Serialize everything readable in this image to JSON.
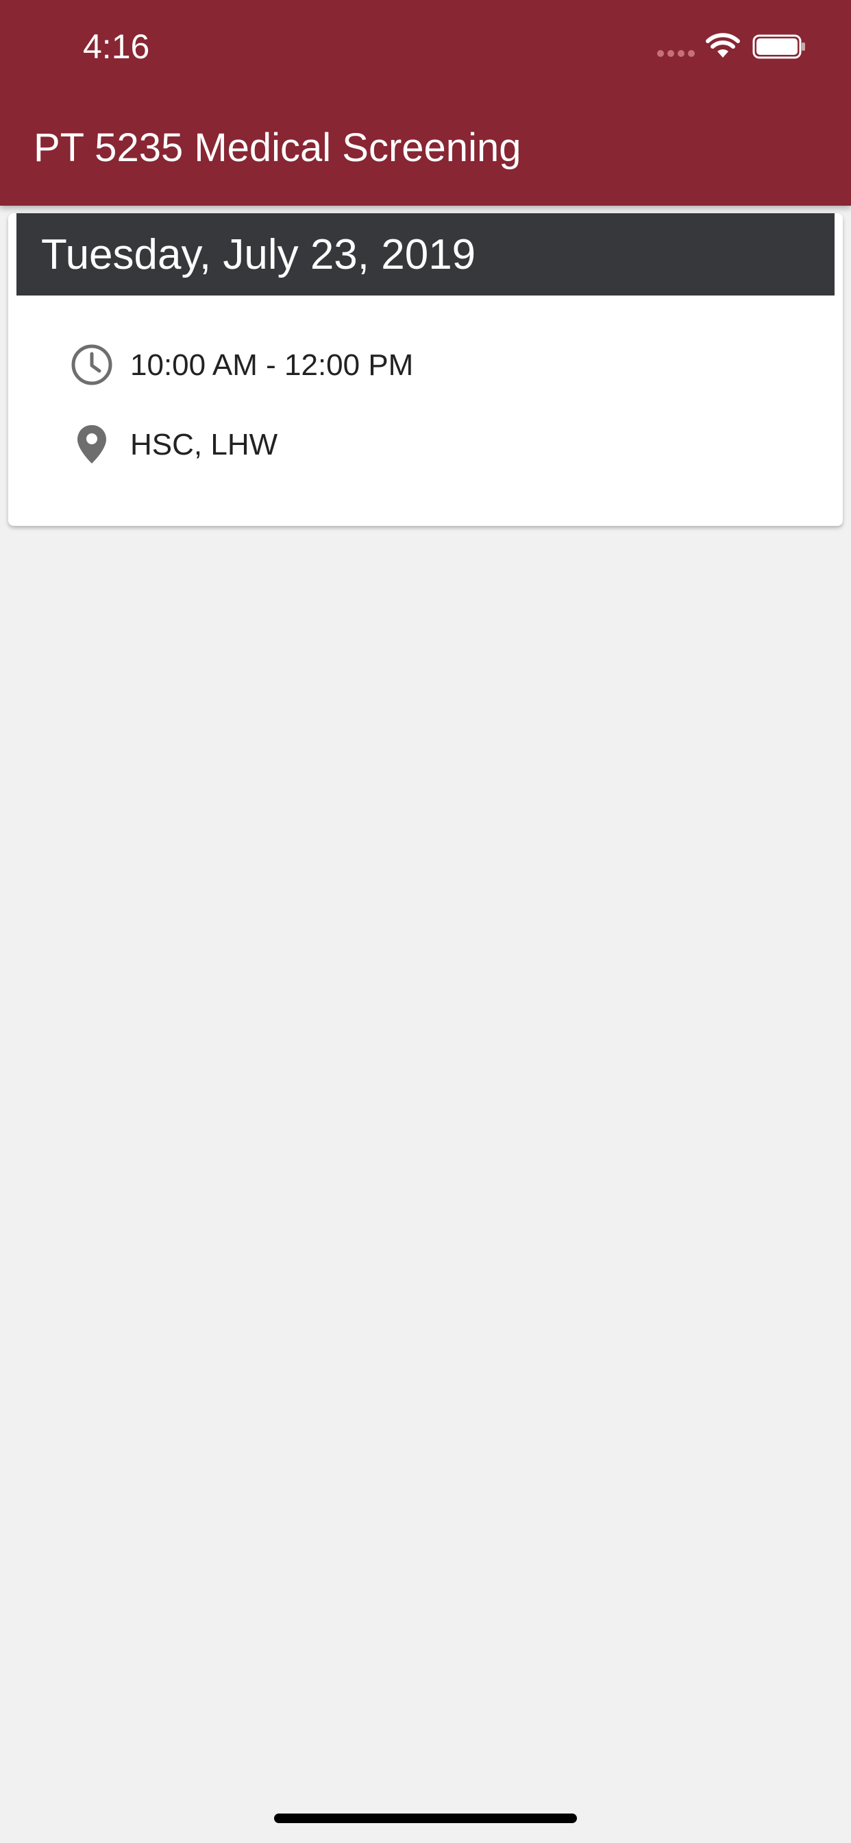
{
  "status_bar": {
    "time": "4:16",
    "icons": [
      "signal-icon",
      "wifi-icon",
      "battery-icon"
    ]
  },
  "header": {
    "title": "PT 5235 Medical Screening"
  },
  "event_card": {
    "date": "Tuesday, July 23, 2019",
    "time_range": "10:00 AM - 12:00 PM",
    "location": "HSC, LHW",
    "icons": {
      "time": "clock-icon",
      "location": "map-pin-icon"
    }
  },
  "colors": {
    "header_bg": "#882633",
    "date_bar_bg": "#37383c",
    "page_bg": "#f1f1f1",
    "icon_gray": "#6e6e6e"
  }
}
